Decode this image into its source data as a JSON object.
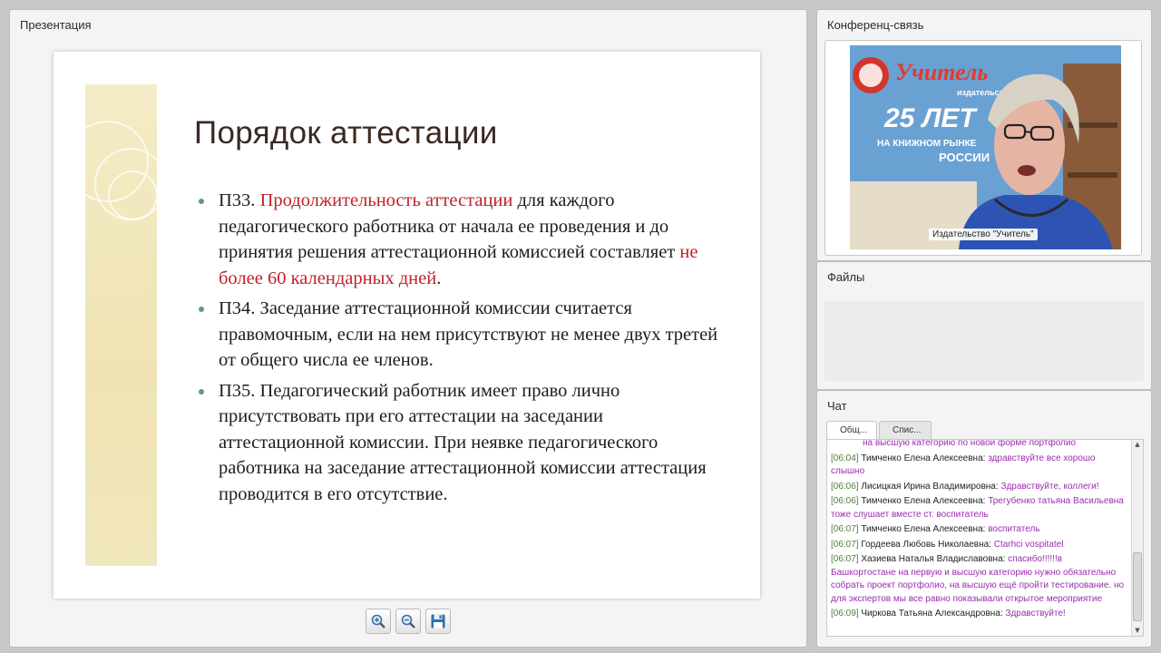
{
  "presentation": {
    "panel_title": "Презентация",
    "slide_title": "Порядок аттестации",
    "bullets": [
      {
        "parts": [
          {
            "text": "П33. ",
            "hl": false
          },
          {
            "text": "Продолжительность аттестации",
            "hl": true
          },
          {
            "text": " для каждого педагогического работника от начала ее проведения и до принятия решения аттестационной комиссией составляет ",
            "hl": false
          },
          {
            "text": "не более 60 календарных дней",
            "hl": true
          },
          {
            "text": ".",
            "hl": false
          }
        ]
      },
      {
        "parts": [
          {
            "text": "П34. Заседание аттестационной комиссии считается правомочным, если на нем присутствуют не менее двух третей от общего числа ее членов.",
            "hl": false
          }
        ]
      },
      {
        "parts": [
          {
            "text": "П35. Педагогический работник имеет право лично присутствовать при его аттестации на заседании аттестационной комиссии. При неявке педагогического работника на заседание аттестационной комиссии аттестация проводится в его отсутствие.",
            "hl": false
          }
        ]
      }
    ],
    "toolbar": {
      "zoom_in_icon": "zoom-in-icon",
      "zoom_out_icon": "zoom-out-icon",
      "save_icon": "floppy-disk-icon"
    }
  },
  "conference": {
    "panel_title": "Конференц-связь",
    "video_caption": "Издательство \"Учитель\"",
    "video_banner": "Учитель",
    "video_banner_sub": "издательство",
    "video_years": "25 ЛЕТ",
    "video_line1": "НА КНИЖНОМ РЫНКЕ",
    "video_line2": "РОССИИ"
  },
  "files": {
    "panel_title": "Файлы"
  },
  "chat": {
    "panel_title": "Чат",
    "tabs": [
      "Общ...",
      "Спис..."
    ],
    "messages": [
      {
        "time": "",
        "name": "",
        "text": "на высшую категорию по новой форме портфолио"
      },
      {
        "time": "[06:04]",
        "name": "Тимченко Елена Алексеевна:",
        "text": "здравствуйте все хорошо слышно"
      },
      {
        "time": "[06:06]",
        "name": "Лисицкая Ирина Владимировна:",
        "text": "Здравствуйте, коллеги!"
      },
      {
        "time": "[06:06]",
        "name": "Тимченко Елена Алексеевна:",
        "text": "Трегубенко татьяна Васильевна тоже слушает вместе ст. воспитатель"
      },
      {
        "time": "[06:07]",
        "name": "Тимченко Елена Алексеевна:",
        "text": "воспитатель"
      },
      {
        "time": "[06:07]",
        "name": "Гордеева Любовь Николаевна:",
        "text": "Ctarhci vospitatel"
      },
      {
        "time": "[06:07]",
        "name": "Хазиева Наталья Владиславовна:",
        "text": "спасибо!!!!!!в Башкортостане на первую и высшую категорию нужно обязательно собрать проект портфолио, на высшую ещё пройти тестирование. но для экспертов мы все равно показывали открытое мероприятие"
      },
      {
        "time": "[06:09]",
        "name": "Чиркова Татьяна Александровна:",
        "text": "Здравствуйте!"
      }
    ]
  }
}
